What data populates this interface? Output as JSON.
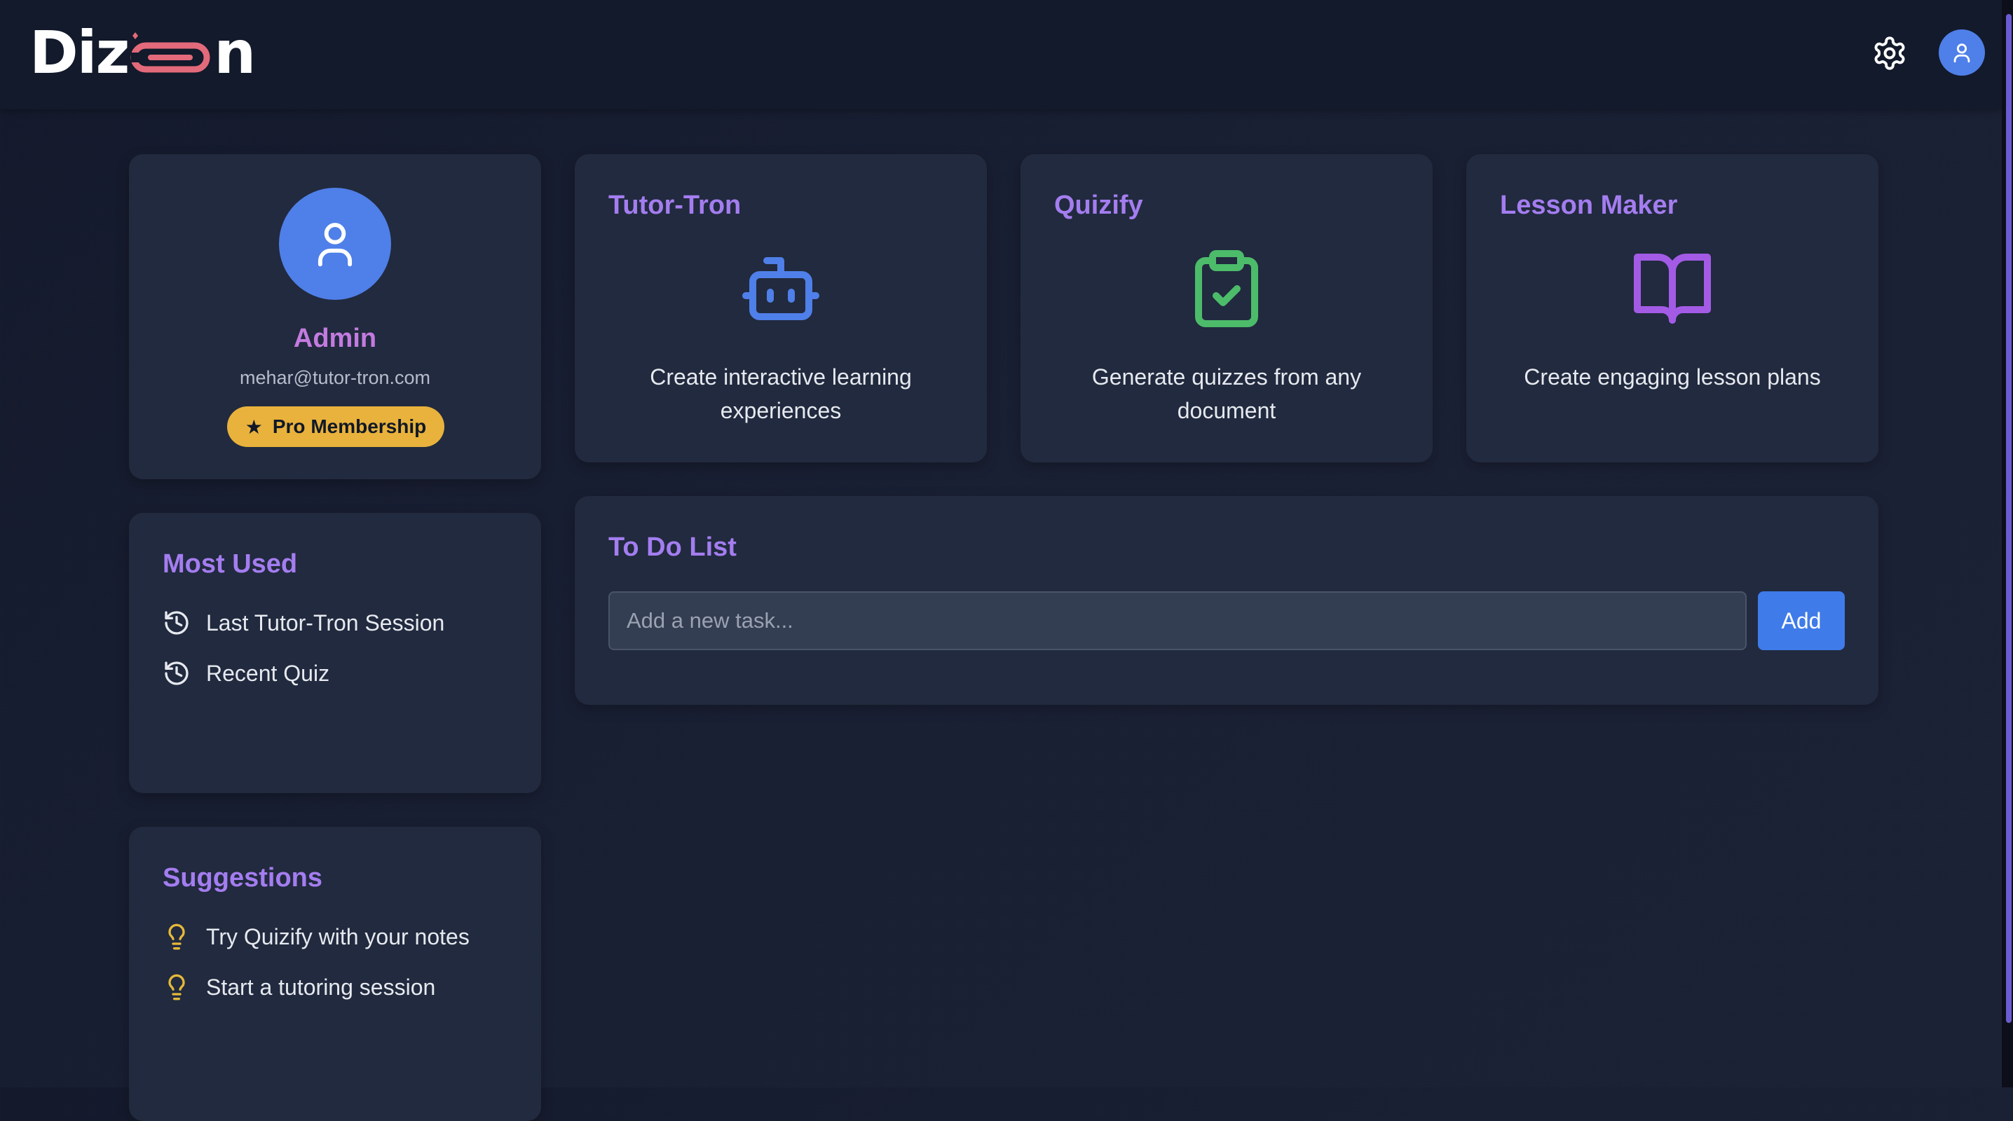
{
  "app": {
    "logo_text_left": "Diz",
    "logo_text_right": "n"
  },
  "header": {
    "settings_icon": "gear-icon",
    "avatar_icon": "user-icon"
  },
  "profile": {
    "name": "Admin",
    "email": "mehar@tutor-tron.com",
    "badge_icon": "★",
    "badge_label": "Pro Membership"
  },
  "tools": [
    {
      "title": "Tutor-Tron",
      "icon": "bot-icon",
      "icon_color": "#4f7fe8",
      "description": "Create interactive learning experiences"
    },
    {
      "title": "Quizify",
      "icon": "clipboard-check-icon",
      "icon_color": "#4cbc6b",
      "description": "Generate quizzes from any document"
    },
    {
      "title": "Lesson Maker",
      "icon": "book-open-icon",
      "icon_color": "#a35be6",
      "description": "Create engaging lesson plans"
    }
  ],
  "most_used": {
    "title": "Most Used",
    "items": [
      {
        "label": "Last Tutor-Tron Session",
        "icon": "history-icon"
      },
      {
        "label": "Recent Quiz",
        "icon": "history-icon"
      }
    ]
  },
  "suggestions": {
    "title": "Suggestions",
    "items": [
      {
        "label": "Try Quizify with your notes",
        "icon": "lightbulb-icon"
      },
      {
        "label": "Start a tutoring session",
        "icon": "lightbulb-icon"
      }
    ]
  },
  "todo": {
    "title": "To Do List",
    "placeholder": "Add a new task...",
    "add_label": "Add"
  },
  "colors": {
    "accent_purple": "#a47df0",
    "profile_name": "#c47be0",
    "primary_blue": "#3f7be9",
    "badge_gold": "#e8b23c",
    "bulb_yellow": "#e6b93a",
    "card_bg": "#212a3e",
    "header_bg": "#121a2b"
  }
}
